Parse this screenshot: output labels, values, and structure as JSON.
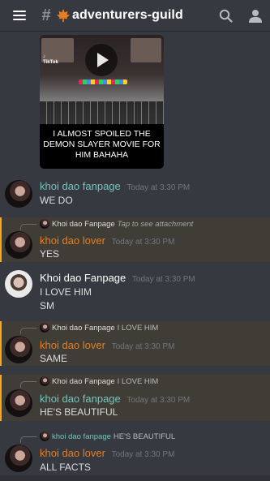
{
  "header": {
    "channel_name": "adventurers-guild",
    "hash": "#",
    "icons": [
      "menu-icon",
      "maple-leaf-icon",
      "search-icon",
      "members-icon"
    ]
  },
  "video": {
    "app_label": "TikTok",
    "caption": "I ALMOST SPOILED THE DEMON SLAYER MOVIE FOR HIM BAHAHA"
  },
  "colors": {
    "teal_name": "#76c3bd",
    "orange_name": "#e67e22",
    "highlight_bar": "#faa81a"
  },
  "messages": [
    {
      "author": "khoi dao fanpage",
      "timestamp": "Today at 3:30 PM",
      "text": "WE DO"
    },
    {
      "reply_to": "Khoi dao Fanpage",
      "reply_text": "Tap to see attachment",
      "author": "khoi dao lover",
      "timestamp": "Today at 3:30 PM",
      "text": "YES"
    },
    {
      "author": "Khoi dao Fanpage",
      "timestamp": "Today at 3:30 PM",
      "text_lines": [
        "I LOVE HIM",
        "SM"
      ]
    },
    {
      "reply_to": "Khoi dao Fanpage",
      "reply_text": "I LOVE HIM",
      "author": "khoi dao lover",
      "timestamp": "Today at 3:30 PM",
      "text": "SAME"
    },
    {
      "reply_to": "Khoi dao Fanpage",
      "reply_text": "I LOVE HIM",
      "author": "khoi dao fanpage",
      "timestamp": "Today at 3:30 PM",
      "text": "HE'S BEAUTIFUL"
    },
    {
      "reply_to": "khoi dao fanpage",
      "reply_text": "HE'S BEAUTIFUL",
      "author": "khoi dao lover",
      "timestamp": "Today at 3:30 PM",
      "text": "ALL FACTS"
    }
  ]
}
